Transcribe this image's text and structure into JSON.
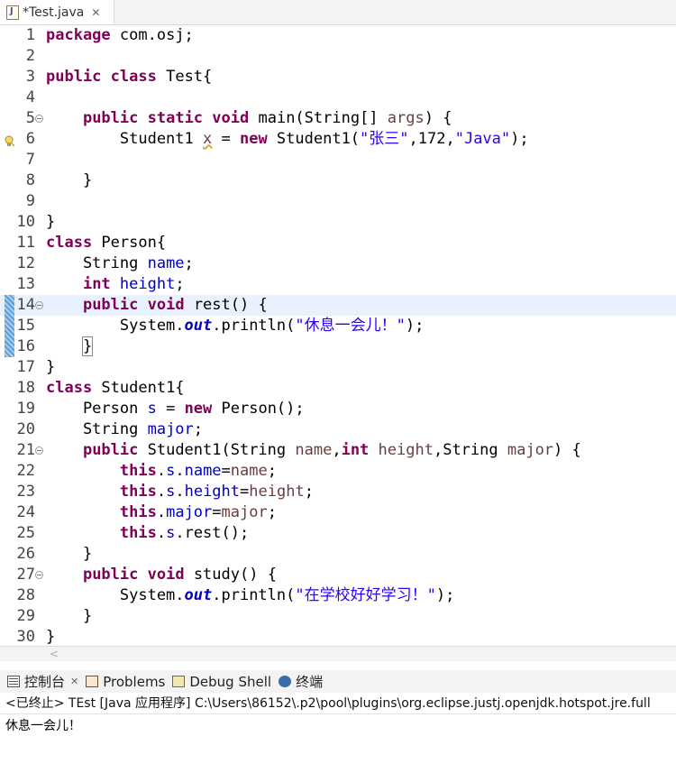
{
  "editor_tab": {
    "title": "*Test.java",
    "icon": "java-file-icon",
    "close_glyph": "✕"
  },
  "code_lines": [
    {
      "n": "1",
      "html": "<span class=\"kw\">package</span> com.osj;"
    },
    {
      "n": "2",
      "html": ""
    },
    {
      "n": "3",
      "html": "<span class=\"kw\">public</span> <span class=\"kw\">class</span> Test{"
    },
    {
      "n": "4",
      "html": ""
    },
    {
      "n": "5",
      "html": "    <span class=\"kw\">public</span> <span class=\"kw\">static</span> <span class=\"kw\">void</span> main(String[] <span class=\"loc\">args</span>) {",
      "fold": true
    },
    {
      "n": "6",
      "html": "        Student1 <span class=\"loc warn\">x</span> = <span class=\"kw\">new</span> Student1(<span class=\"str\">\"张三\"</span>,172,<span class=\"str\">\"Java\"</span>);",
      "bulb": true
    },
    {
      "n": "7",
      "html": ""
    },
    {
      "n": "8",
      "html": "    }"
    },
    {
      "n": "9",
      "html": ""
    },
    {
      "n": "10",
      "html": "}"
    },
    {
      "n": "11",
      "html": "<span class=\"kw\">class</span> Person{"
    },
    {
      "n": "12",
      "html": "    String <span class=\"fld\">name</span>;"
    },
    {
      "n": "13",
      "html": "    <span class=\"kw\">int</span> <span class=\"fld\">height</span>;"
    },
    {
      "n": "14",
      "html": "    <span class=\"kw\">public</span> <span class=\"kw\">void</span> rest() {",
      "fold": true,
      "highlight": true,
      "mark": true
    },
    {
      "n": "15",
      "html": "        System.<span class=\"sfld\">out</span>.println(<span class=\"str\">\"休息一会儿！\"</span>);",
      "mark": true
    },
    {
      "n": "16",
      "html": "    <span class=\"bracebox\">}</span>",
      "mark": true
    },
    {
      "n": "17",
      "html": "}"
    },
    {
      "n": "18",
      "html": "<span class=\"kw\">class</span> Student1{"
    },
    {
      "n": "19",
      "html": "    Person <span class=\"fld\">s</span> = <span class=\"kw\">new</span> Person();"
    },
    {
      "n": "20",
      "html": "    String <span class=\"fld\">major</span>;"
    },
    {
      "n": "21",
      "html": "    <span class=\"kw\">public</span> Student1(String <span class=\"loc\">name</span>,<span class=\"kw\">int</span> <span class=\"loc\">height</span>,String <span class=\"loc\">major</span>) {",
      "fold": true
    },
    {
      "n": "22",
      "html": "        <span class=\"kw\">this</span>.<span class=\"fld\">s</span>.<span class=\"fld\">name</span>=<span class=\"loc\">name</span>;"
    },
    {
      "n": "23",
      "html": "        <span class=\"kw\">this</span>.<span class=\"fld\">s</span>.<span class=\"fld\">height</span>=<span class=\"loc\">height</span>;"
    },
    {
      "n": "24",
      "html": "        <span class=\"kw\">this</span>.<span class=\"fld\">major</span>=<span class=\"loc\">major</span>;"
    },
    {
      "n": "25",
      "html": "        <span class=\"kw\">this</span>.<span class=\"fld\">s</span>.rest();"
    },
    {
      "n": "26",
      "html": "    }"
    },
    {
      "n": "27",
      "html": "    <span class=\"kw\">public</span> <span class=\"kw\">void</span> study() {",
      "fold": true
    },
    {
      "n": "28",
      "html": "        System.<span class=\"sfld\">out</span>.println(<span class=\"str\">\"在学校好好学习！\"</span>);"
    },
    {
      "n": "29",
      "html": "    }"
    },
    {
      "n": "30",
      "html": "}"
    }
  ],
  "scroll_arrow": "<",
  "console_tabs": [
    {
      "label": "控制台",
      "icon": "console-icon",
      "close": "✕"
    },
    {
      "label": "Problems",
      "icon": "problems-icon"
    },
    {
      "label": "Debug Shell",
      "icon": "debug-shell-icon"
    },
    {
      "label": "终端",
      "icon": "terminal-icon"
    }
  ],
  "console_status": "<已终止> TEst [Java 应用程序] C:\\Users\\86152\\.p2\\pool\\plugins\\org.eclipse.justj.openjdk.hotspot.jre.full",
  "console_output": "休息一会儿！",
  "colors": {
    "keyword": "#7f0055",
    "field": "#0000c0",
    "string": "#2a00ff",
    "highlight_line": "#e8f2fe"
  }
}
